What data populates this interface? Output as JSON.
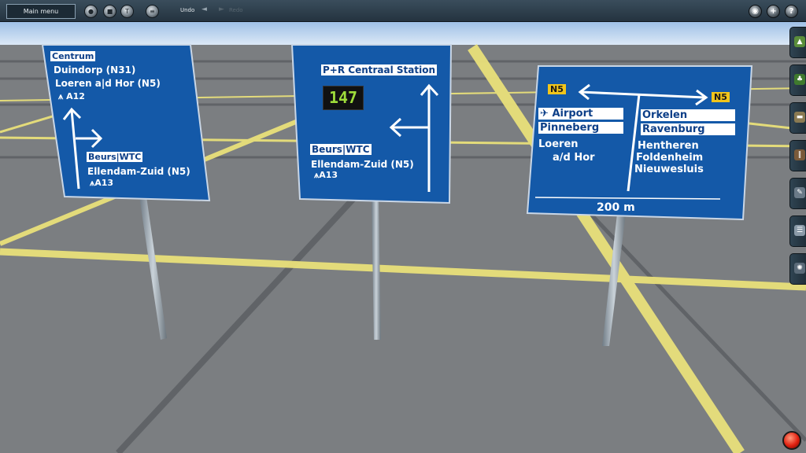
{
  "toolbar": {
    "main_menu": "Main menu",
    "undo": "Undo",
    "redo": "Redo"
  },
  "sign1": {
    "top_box": "Centrum",
    "line1": "Duindorp (N31)",
    "line2": "Loeren a|d Hor (N5)",
    "line3": "A12",
    "bottom_box": "Beurs|WTC",
    "line4": "Ellendam-Zuid (N5)",
    "line5": "A13"
  },
  "sign2": {
    "top_box": "P+R Centraal Station",
    "display": "147",
    "bottom_box": "Beurs|WTC",
    "line1": "Ellendam-Zuid (N5)",
    "line2": "A13"
  },
  "sign3": {
    "left_route": "N5",
    "right_route": "N5",
    "left_box1": "Airport",
    "left_box2": "Pinneberg",
    "left_line1": "Loeren",
    "left_line2": "a/d Hor",
    "right_box1": "Orkelen",
    "right_box2": "Ravenburg",
    "right_line1": "Hentheren",
    "right_line2": "Foldenheim",
    "right_line3": "Nieuwesluis",
    "distance": "200 m"
  },
  "colors": {
    "sign_blue": "#1459a8",
    "road_yellow": "#e9e07a",
    "sky": "#b9d3ee",
    "ground": "#7a7d80"
  }
}
